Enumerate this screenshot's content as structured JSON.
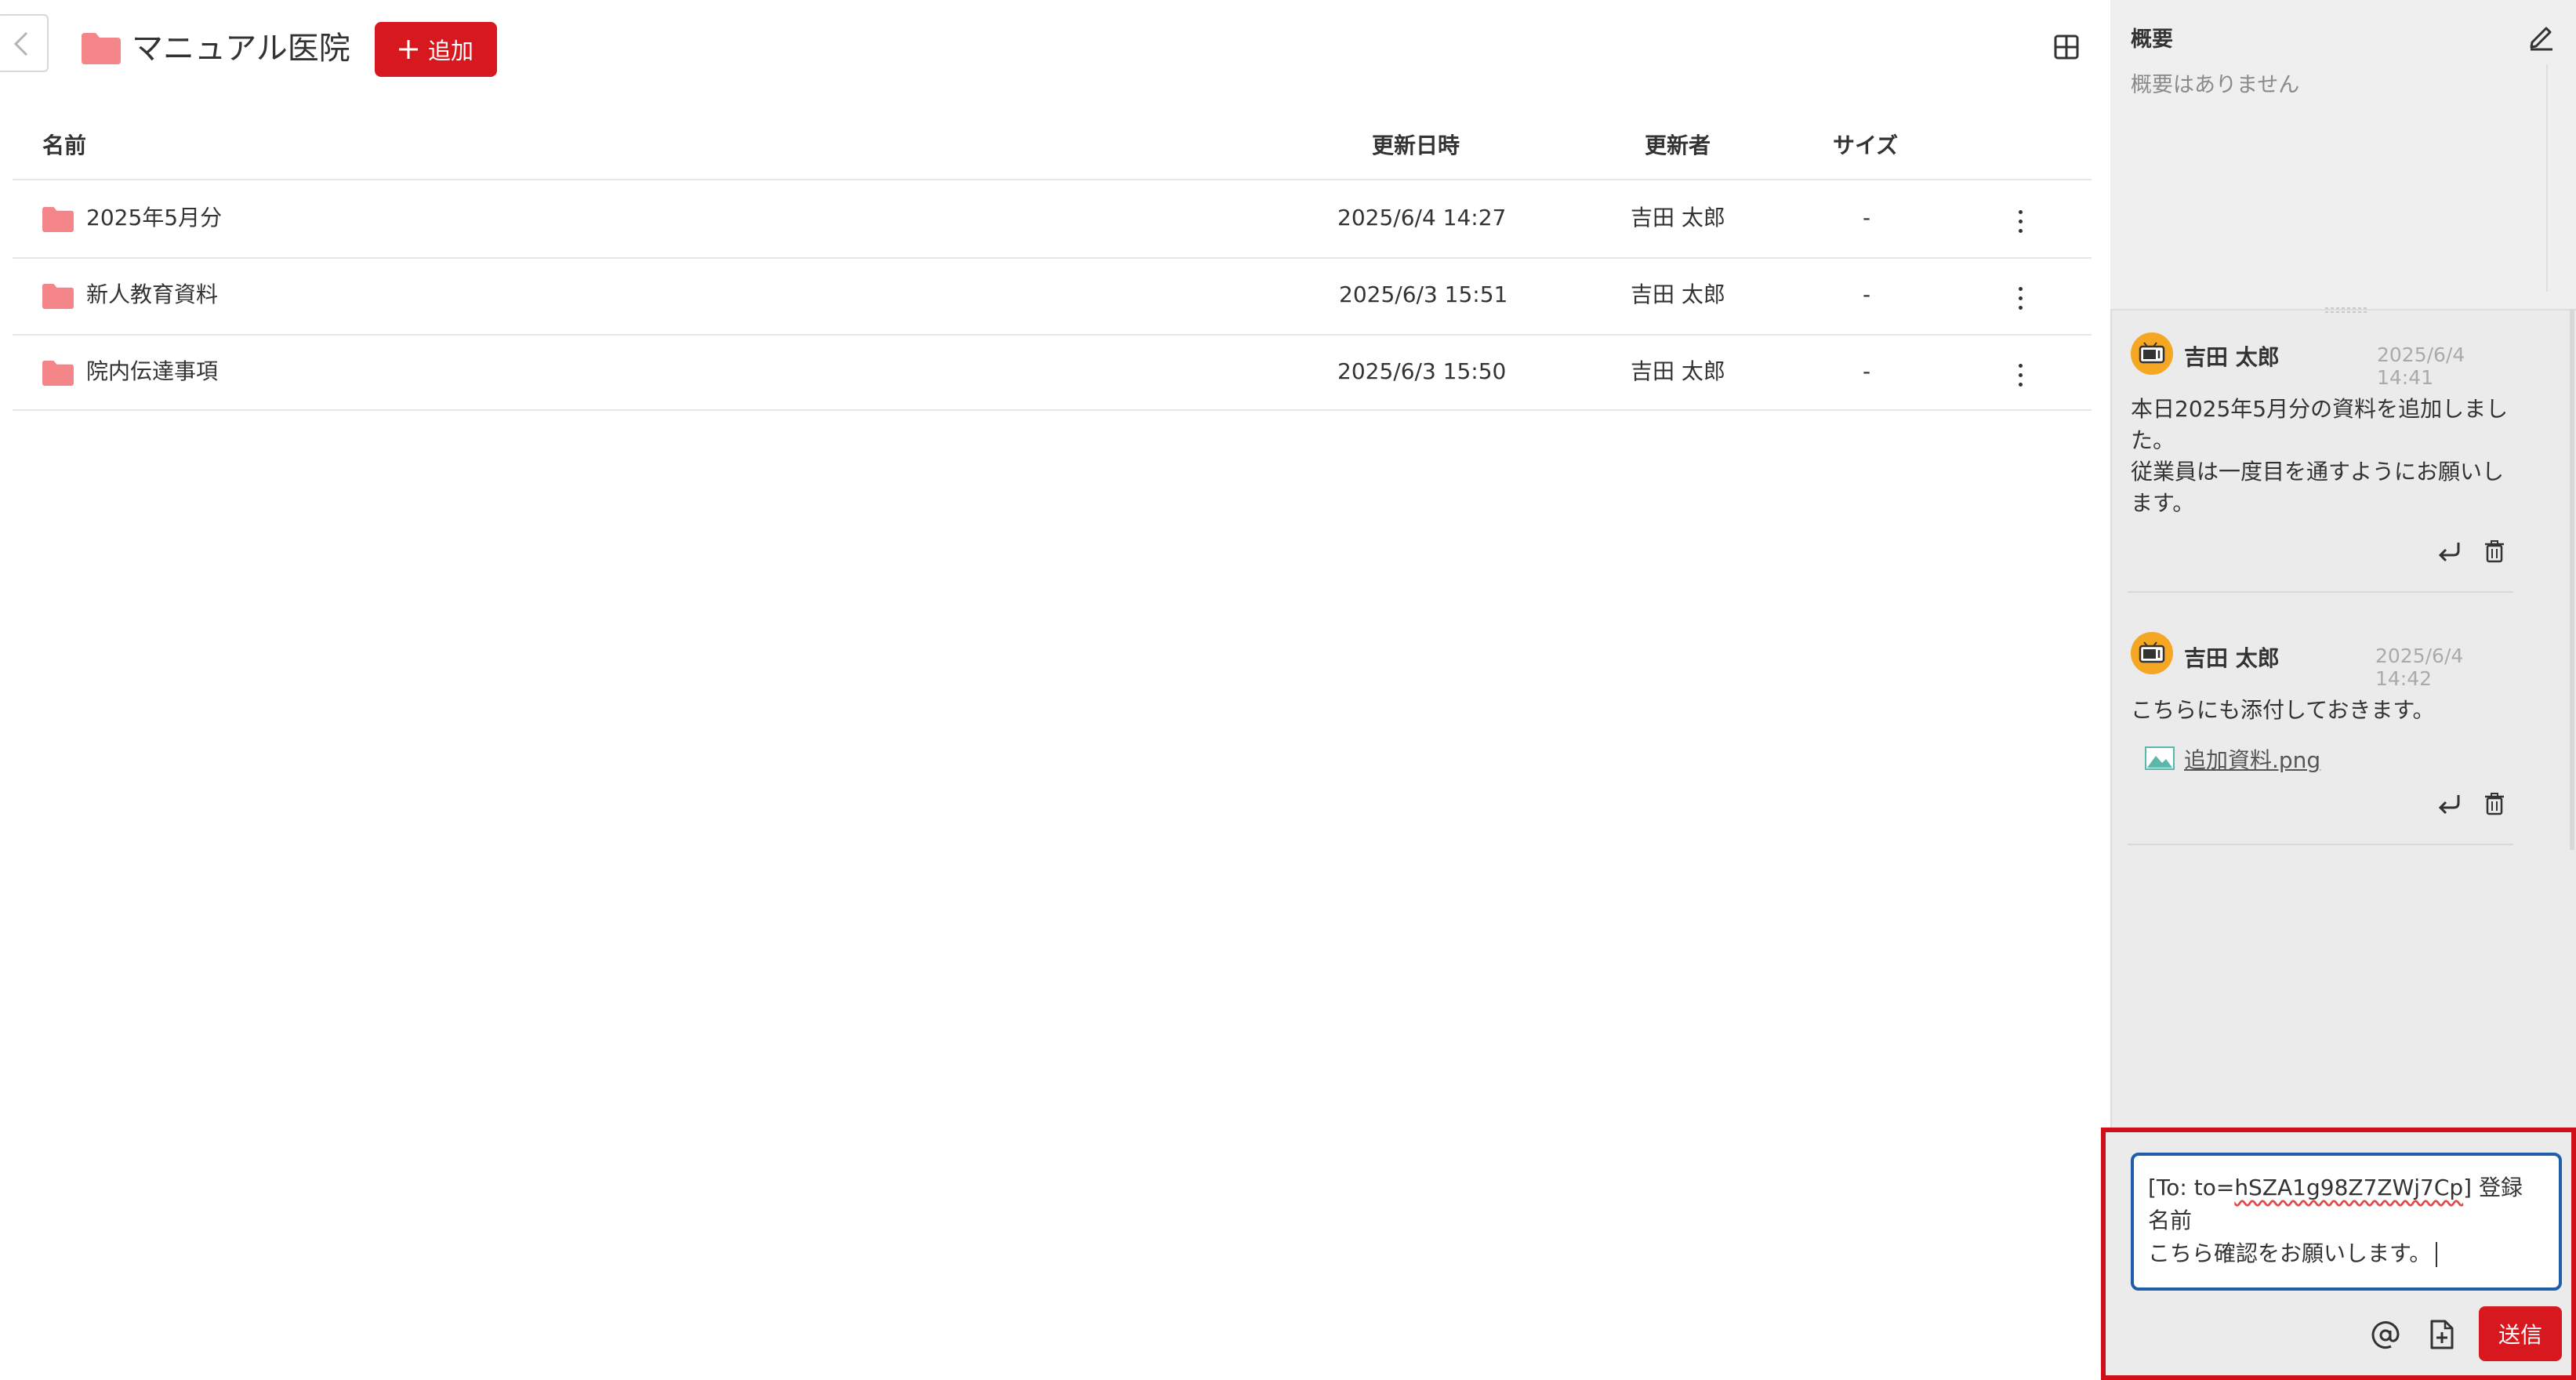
{
  "header": {
    "folder_title": "マニュアル医院",
    "add_button_label": "追加"
  },
  "table": {
    "columns": {
      "name": "名前",
      "updated_at": "更新日時",
      "updated_by": "更新者",
      "size": "サイズ"
    },
    "rows": [
      {
        "name": "2025年5月分",
        "updated_at": "2025/6/4 14:27",
        "updated_by": "吉田 太郎",
        "size": "-"
      },
      {
        "name": "新人教育資料",
        "updated_at": "2025/6/3 15:51",
        "updated_by": "吉田 太郎",
        "size": "-"
      },
      {
        "name": "院内伝達事項",
        "updated_at": "2025/6/3 15:50",
        "updated_by": "吉田 太郎",
        "size": "-"
      }
    ]
  },
  "summary": {
    "title": "概要",
    "empty_text": "概要はありません"
  },
  "messages": [
    {
      "author": "吉田 太郎",
      "time": "2025/6/4 14:41",
      "lines": [
        "本日2025年5月分の資料を追加しまし",
        "た。",
        "従業員は一度目を通すようにお願いし",
        "ます。"
      ]
    },
    {
      "author": "吉田 太郎",
      "time": "2025/6/4 14:42",
      "lines": [
        "こちらにも添付しておきます。"
      ],
      "attachment": "追加資料.png"
    }
  ],
  "compose": {
    "to_prefix": "[To: to=",
    "to_id": "hSZA1g98Z7ZWj7Cp",
    "to_suffix": "] 登録 名前",
    "line2": "こちら確認をお願いします。",
    "send_label": "送信"
  },
  "colors": {
    "accent_red": "#d7191f",
    "folder_pink": "#f4868a",
    "avatar_orange": "#f5a623",
    "focus_blue": "#1f5ea8"
  },
  "icons": {
    "back": "chevron-left-icon",
    "folder": "folder-icon",
    "add": "plus-icon",
    "view": "grid-view-icon",
    "more": "more-vertical-icon",
    "edit": "edit-icon",
    "reply": "reply-icon",
    "delete": "trash-icon",
    "image": "image-icon",
    "mention": "at-sign-icon",
    "attach": "file-add-icon"
  }
}
